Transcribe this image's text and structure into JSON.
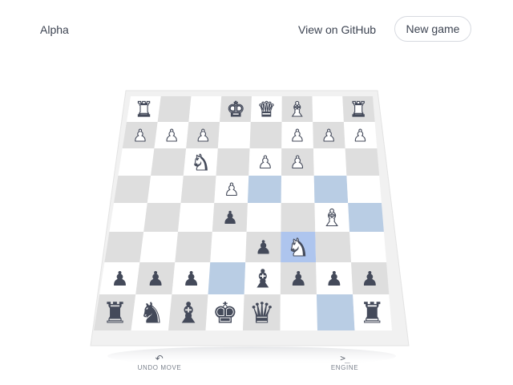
{
  "header": {
    "logo": "Alpha",
    "github_link": "View on GitHub",
    "new_game_label": "New game"
  },
  "colors": {
    "light_square": "#ffffff",
    "dark_square": "#dedede",
    "highlight_square": "#b9cde4",
    "knight_highlight": "#aec5ee",
    "white_piece": "#ffffff",
    "piece_outline": "#444a5a",
    "black_piece": "#444a5a"
  },
  "board": {
    "files": [
      "a",
      "b",
      "c",
      "d",
      "e",
      "f",
      "g",
      "h"
    ],
    "highlight_squares": [
      "e5",
      "g5",
      "h4",
      "d2",
      "g1"
    ],
    "selected_square": "f3",
    "pieces": [
      {
        "square": "a8",
        "type": "rook",
        "color": "white"
      },
      {
        "square": "d8",
        "type": "king",
        "color": "white"
      },
      {
        "square": "e8",
        "type": "queen",
        "color": "white"
      },
      {
        "square": "f8",
        "type": "bishop",
        "color": "white"
      },
      {
        "square": "h8",
        "type": "rook",
        "color": "white"
      },
      {
        "square": "a7",
        "type": "pawn",
        "color": "white"
      },
      {
        "square": "b7",
        "type": "pawn",
        "color": "white"
      },
      {
        "square": "c7",
        "type": "pawn",
        "color": "white"
      },
      {
        "square": "f7",
        "type": "pawn",
        "color": "white"
      },
      {
        "square": "g7",
        "type": "pawn",
        "color": "white"
      },
      {
        "square": "h7",
        "type": "pawn",
        "color": "white"
      },
      {
        "square": "c6",
        "type": "knight",
        "color": "white"
      },
      {
        "square": "e6",
        "type": "pawn",
        "color": "white"
      },
      {
        "square": "f6",
        "type": "pawn",
        "color": "white"
      },
      {
        "square": "d5",
        "type": "pawn",
        "color": "white"
      },
      {
        "square": "d4",
        "type": "pawn",
        "color": "black"
      },
      {
        "square": "g4",
        "type": "bishop",
        "color": "white"
      },
      {
        "square": "e3",
        "type": "pawn",
        "color": "black"
      },
      {
        "square": "f3",
        "type": "knight",
        "color": "white"
      },
      {
        "square": "a2",
        "type": "pawn",
        "color": "black"
      },
      {
        "square": "b2",
        "type": "pawn",
        "color": "black"
      },
      {
        "square": "c2",
        "type": "pawn",
        "color": "black"
      },
      {
        "square": "e2",
        "type": "bishop",
        "color": "black"
      },
      {
        "square": "f2",
        "type": "pawn",
        "color": "black"
      },
      {
        "square": "g2",
        "type": "pawn",
        "color": "black"
      },
      {
        "square": "h2",
        "type": "pawn",
        "color": "black"
      },
      {
        "square": "a1",
        "type": "rook",
        "color": "black"
      },
      {
        "square": "b1",
        "type": "knight",
        "color": "black"
      },
      {
        "square": "c1",
        "type": "bishop",
        "color": "black"
      },
      {
        "square": "d1",
        "type": "king",
        "color": "black"
      },
      {
        "square": "e1",
        "type": "queen",
        "color": "black"
      },
      {
        "square": "h1",
        "type": "rook",
        "color": "black"
      }
    ]
  },
  "controls": {
    "undo_label": "UNDO MOVE",
    "undo_icon": "undo-arrow-icon",
    "engine_label": "ENGINE",
    "engine_icon": "terminal-prompt-icon"
  }
}
